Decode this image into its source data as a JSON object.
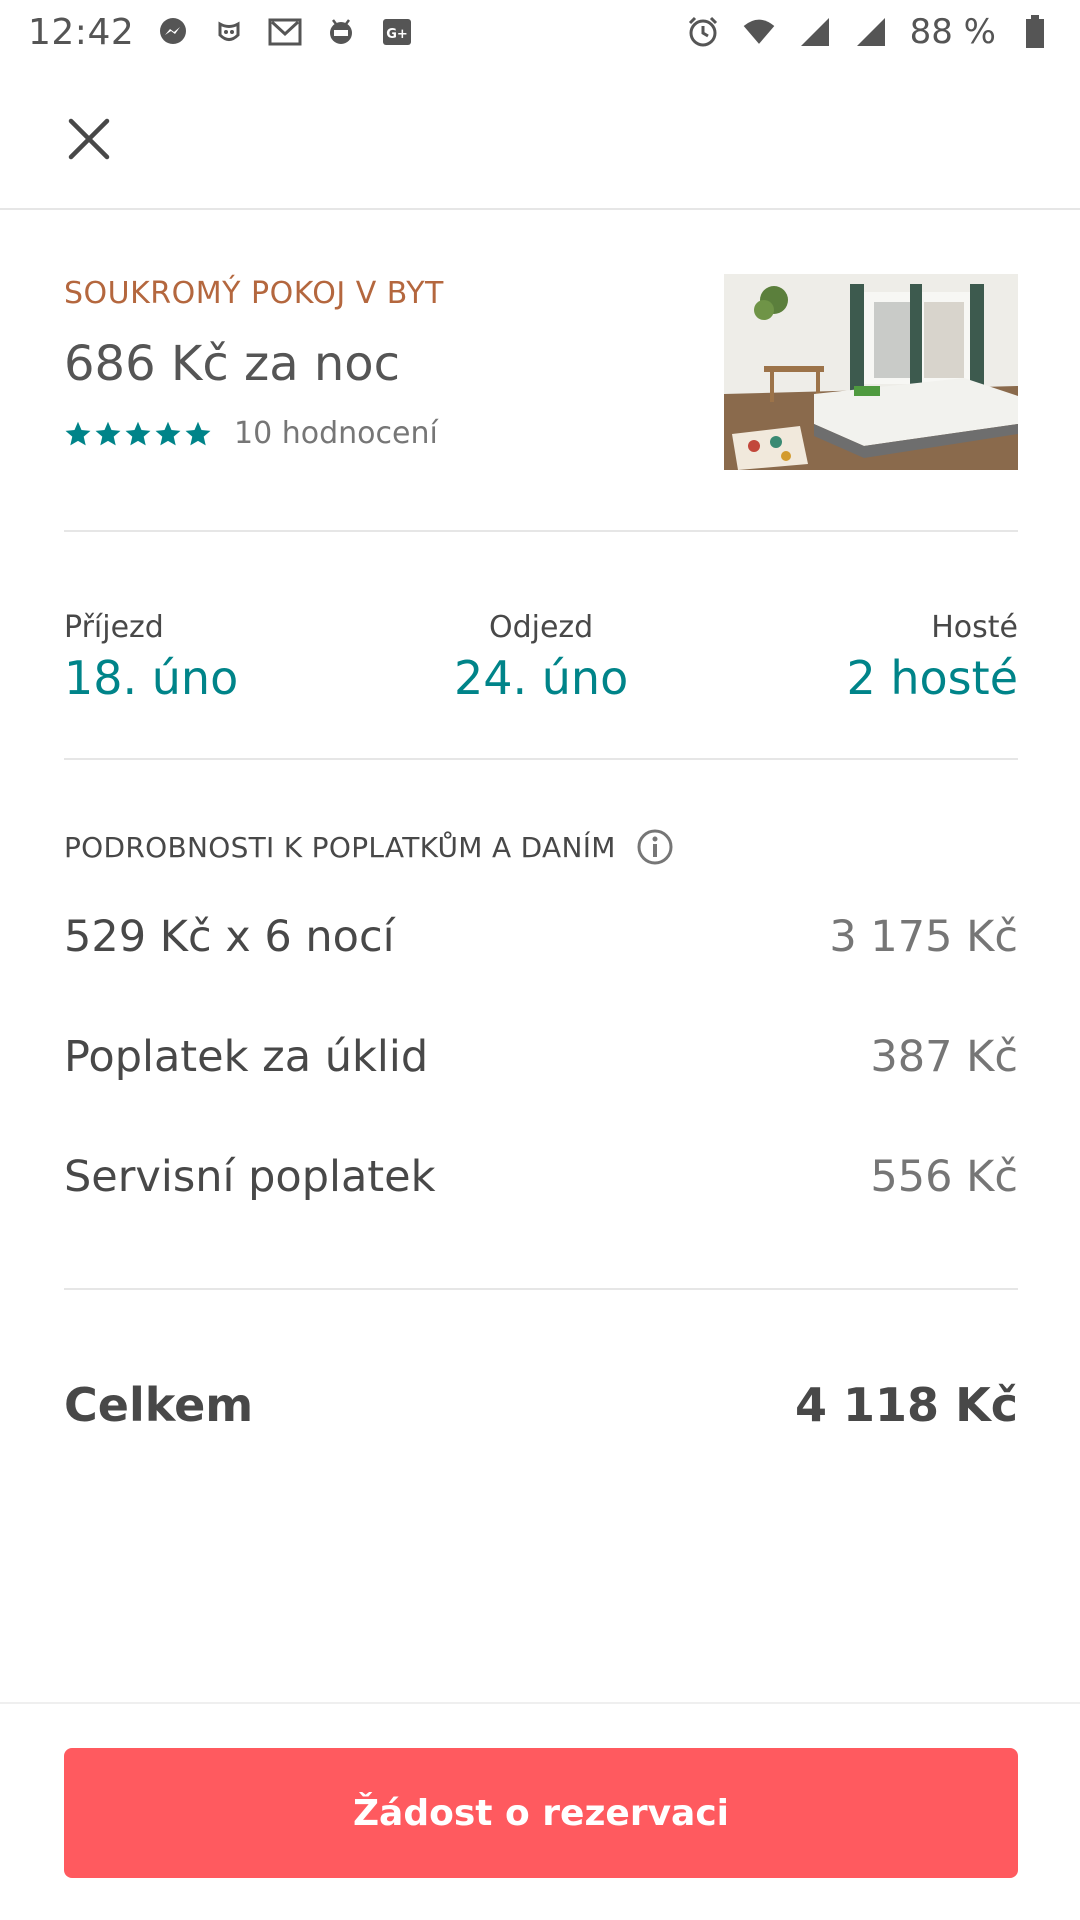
{
  "status_bar": {
    "time": "12:42",
    "battery": "88 %",
    "icons_left": [
      "messenger-icon",
      "bot-icon",
      "gmail-icon",
      "android-icon",
      "google-plus-icon"
    ],
    "icons_right": [
      "alarm-icon",
      "wifi-icon",
      "signal-icon",
      "signal-icon",
      "battery-icon"
    ]
  },
  "header": {
    "close_icon": "close-icon"
  },
  "listing": {
    "type": "SOUKROMÝ POKOJ V BYT",
    "price": "686 Kč za noc",
    "rating_stars": 5,
    "reviews": "10 hodnocení"
  },
  "trip": {
    "checkin_label": "Příjezd",
    "checkin_value": "18. úno",
    "checkout_label": "Odjezd",
    "checkout_value": "24. úno",
    "guests_label": "Hosté",
    "guests_value": "2 hosté"
  },
  "price_details": {
    "heading": "PODROBNOSTI K POPLATKŮM A DANÍM",
    "rows": [
      {
        "label": "529 Kč x 6 nocí",
        "amount": "3 175 Kč"
      },
      {
        "label": "Poplatek za úklid",
        "amount": "387 Kč"
      },
      {
        "label": "Servisní poplatek",
        "amount": "556 Kč"
      }
    ]
  },
  "total": {
    "label": "Celkem",
    "amount": "4 118 Kč"
  },
  "footer": {
    "button_label": "Žádost o rezervaci"
  },
  "colors": {
    "accent": "#ff5a5f",
    "teal": "#008489",
    "listing_type": "#b4673e"
  }
}
